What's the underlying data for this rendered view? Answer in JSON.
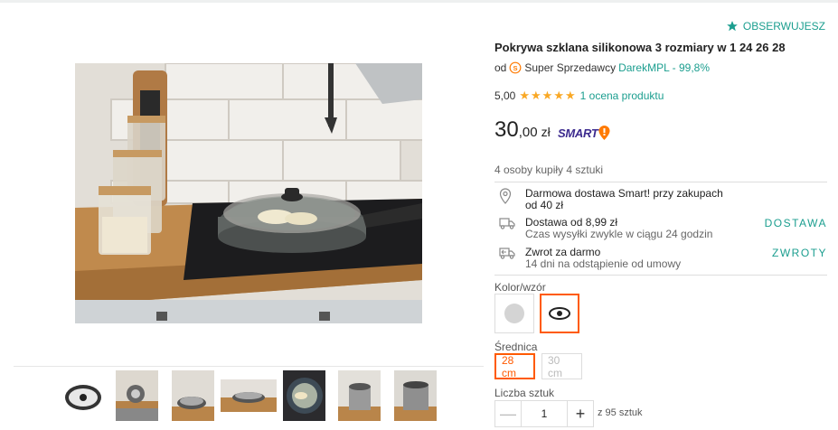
{
  "header": {
    "follow_label": "OBSERWUJESZ"
  },
  "product": {
    "title": "Pokrywa szklana silikonowa 3 rozmiary w 1 24 26 28",
    "seller_prefix": "od",
    "seller_badge": "S",
    "seller_type": "Super Sprzedawcy",
    "seller_name": "DarekMPL - 99,8%",
    "rating_value": "5,00",
    "rating_stars": "★★★★★",
    "rating_count": "1 ocena produktu",
    "price_int": "30",
    "price_dec": ",00",
    "currency": "zł",
    "smart_label": "SMART",
    "bought_text": "4 osoby kupiły 4 sztuki"
  },
  "delivery": {
    "free": {
      "line1": "Darmowa dostawa Smart! przy zakupach",
      "line2": "od 40 zł"
    },
    "shipping": {
      "line1": "Dostawa od 8,99 zł",
      "line2": "Czas wysyłki zwykle w ciągu 24 godzin",
      "action": "DOSTAWA"
    },
    "returns": {
      "line1": "Zwrot za darmo",
      "line2": "14 dni na odstąpienie od umowy",
      "action": "ZWROTY"
    }
  },
  "options": {
    "color_label": "Kolor/wzór",
    "size_label": "Średnica",
    "sizes": [
      "28 cm",
      "30 cm"
    ],
    "selected_size": "28 cm",
    "quantity_label": "Liczba sztuk",
    "quantity_value": "1",
    "minus": "—",
    "plus": "+",
    "stock": "z 95 sztuk"
  },
  "colors": {
    "accent": "#1b9e8f",
    "selected": "#ff5a00",
    "star": "#f9a825",
    "smart": "#3c2a8e"
  },
  "icons": [
    "star-icon",
    "super-seller-badge-icon",
    "location-pin-icon",
    "truck-icon",
    "return-icon",
    "eye-pattern-icon"
  ]
}
